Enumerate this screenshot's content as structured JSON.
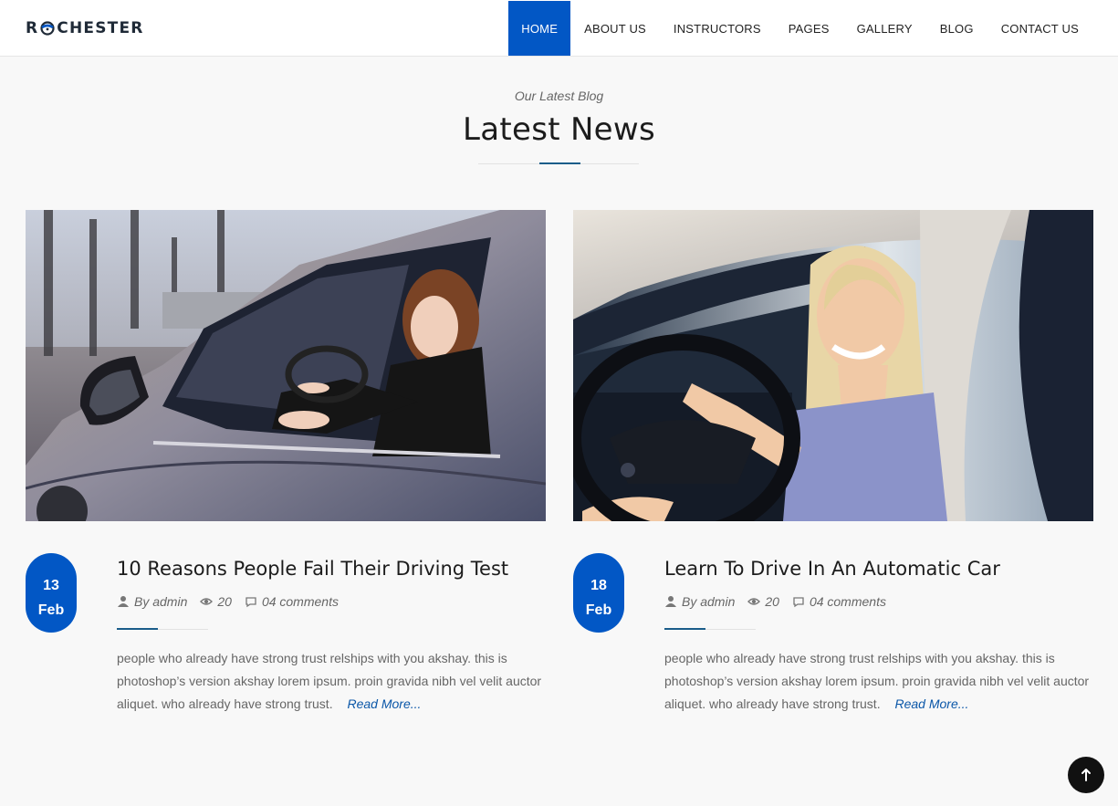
{
  "brand": {
    "logo_text_left": "R",
    "logo_text_right": "CHESTER",
    "accent": "#0257c5"
  },
  "nav": {
    "items": [
      {
        "label": "HOME",
        "active": true
      },
      {
        "label": "ABOUT US"
      },
      {
        "label": "INSTRUCTORS"
      },
      {
        "label": "PAGES"
      },
      {
        "label": "GALLERY"
      },
      {
        "label": "BLOG"
      },
      {
        "label": "CONTACT US"
      }
    ]
  },
  "section": {
    "eyebrow": "Our Latest Blog",
    "title": "Latest News"
  },
  "posts": [
    {
      "day": "13",
      "month": "Feb",
      "title": "10 Reasons People Fail Their Driving Test",
      "author": "By admin",
      "views": "20",
      "comments": "04 comments",
      "excerpt": "people who already have strong trust relships with you akshay. this is photoshop’s version akshay lorem ipsum. proin gravida nibh vel velit auctor aliquet. who already have strong trust.",
      "read_more": "Read More...",
      "image_icon": "woman-in-car-photo"
    },
    {
      "day": "18",
      "month": "Feb",
      "title": "Learn To Drive In An Automatic Car",
      "author": "By admin",
      "views": "20",
      "comments": "04 comments",
      "excerpt": "people who already have strong trust relships with you akshay. this is photoshop’s version akshay lorem ipsum. proin gravida nibh vel velit auctor aliquet. who already have strong trust.",
      "read_more": "Read More...",
      "image_icon": "smiling-driver-photo"
    }
  ]
}
